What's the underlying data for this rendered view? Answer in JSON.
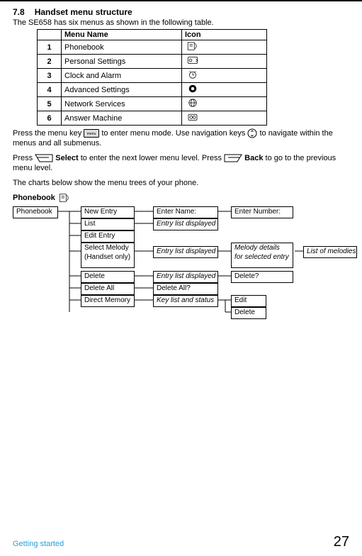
{
  "heading": {
    "num": "7.8",
    "title": "Handset menu structure"
  },
  "intro": "The SE658 has six menus as shown in the following table.",
  "table": {
    "headers": {
      "blank": "",
      "name": "Menu Name",
      "icon": "Icon"
    },
    "rows": [
      {
        "n": "1",
        "name": "Phonebook",
        "icon": "phonebook-icon"
      },
      {
        "n": "2",
        "name": "Personal Settings",
        "icon": "personal-icon"
      },
      {
        "n": "3",
        "name": "Clock and Alarm",
        "icon": "clock-icon"
      },
      {
        "n": "4",
        "name": "Advanced Settings",
        "icon": "advanced-icon"
      },
      {
        "n": "5",
        "name": "Network Services",
        "icon": "network-icon"
      },
      {
        "n": "6",
        "name": "Answer Machine",
        "icon": "answer-icon"
      }
    ]
  },
  "para1a": "Press the menu key ",
  "para1b": " to enter menu mode. Use navigation keys ",
  "para1c": " to navigate within the menus and all submenus.",
  "para2a": "Press ",
  "para2b": " Select",
  "para2c": " to enter the next lower menu level. Press ",
  "para2d": " Back",
  "para2e": " to go to the previous menu level.",
  "para3": "The charts below show the menu trees of your phone.",
  "subheading": "Phonebook",
  "tree": {
    "phonebook": "Phonebook",
    "new_entry": "New Entry",
    "list": "List",
    "edit_entry": "Edit Entry",
    "select_melody_1": "Select Melody",
    "select_melody_2": "(Handset only)",
    "delete": "Delete",
    "delete_all": "Delete All",
    "direct_memory": "Direct Memory",
    "enter_name": "Enter Name:",
    "entry_list_1": "Entry list displayed",
    "entry_list_2": "Entry list displayed",
    "entry_list_3": "Entry list displayed",
    "delete_all_q": "Delete All?",
    "key_list": "Key list and status",
    "enter_number": "Enter Number:",
    "melody_details_1": "Melody details",
    "melody_details_2": "for selected entry",
    "delete_q": "Delete?",
    "edit": "Edit",
    "delete2": "Delete",
    "list_melodies": "List of melodies"
  },
  "footer": {
    "left": "Getting started",
    "right": "27"
  }
}
